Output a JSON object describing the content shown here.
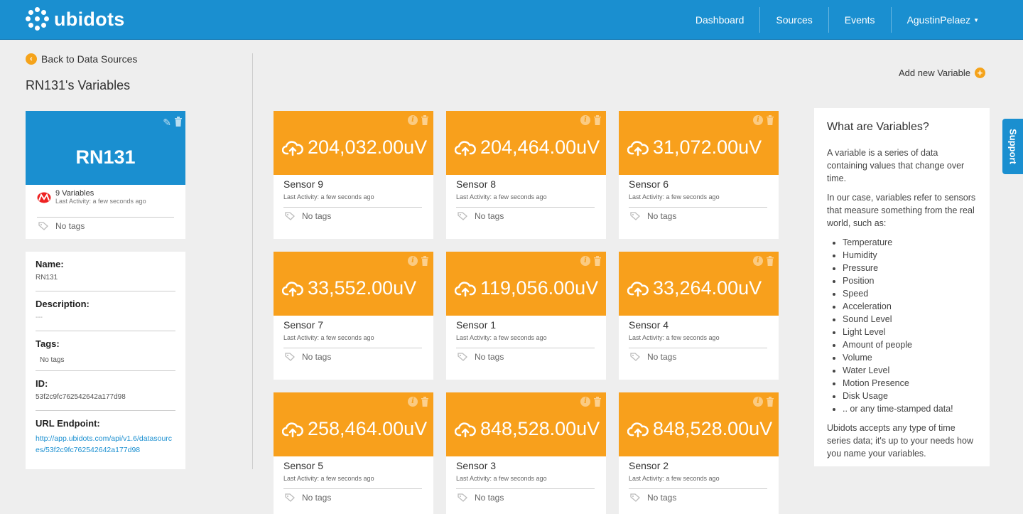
{
  "header": {
    "brand": "ubidots",
    "nav": [
      {
        "label": "Dashboard"
      },
      {
        "label": "Sources"
      },
      {
        "label": "Events"
      },
      {
        "label": "AgustinPelaez"
      }
    ],
    "brand_color": "#1a8fd0"
  },
  "sidebar": {
    "back_label": "Back to Data Sources",
    "page_title": "RN131's Variables",
    "device": {
      "name": "RN131",
      "variables_count": "9 Variables",
      "last_activity": "Last Activity: a few seconds ago",
      "tags": "No tags"
    },
    "details": {
      "name_label": "Name:",
      "name_value": "RN131",
      "description_label": "Description:",
      "description_value": "---",
      "tags_label": "Tags:",
      "tags_value": "No tags",
      "id_label": "ID:",
      "id_value": "53f2c9fc762542642a177d98",
      "url_label": "URL Endpoint:",
      "url_value": "http://app.ubidots.com/api/v1.6/datasources/53f2c9fc762542642a177d98"
    }
  },
  "main": {
    "add_variable_label": "Add new Variable",
    "accent_color": "#f8a01c",
    "variables": [
      {
        "value": "204,032.00uV",
        "name": "Sensor 9",
        "activity": "Last Activity: a few seconds ago",
        "tags": "No tags"
      },
      {
        "value": "204,464.00uV",
        "name": "Sensor 8",
        "activity": "Last Activity: a few seconds ago",
        "tags": "No tags"
      },
      {
        "value": "31,072.00uV",
        "name": "Sensor 6",
        "activity": "Last Activity: a few seconds ago",
        "tags": "No tags"
      },
      {
        "value": "33,552.00uV",
        "name": "Sensor 7",
        "activity": "Last Activity: a few seconds ago",
        "tags": "No tags"
      },
      {
        "value": "119,056.00uV",
        "name": "Sensor 1",
        "activity": "Last Activity: a few seconds ago",
        "tags": "No tags"
      },
      {
        "value": "33,264.00uV",
        "name": "Sensor 4",
        "activity": "Last Activity: a few seconds ago",
        "tags": "No tags"
      },
      {
        "value": "258,464.00uV",
        "name": "Sensor 5",
        "activity": "Last Activity: a few seconds ago",
        "tags": "No tags"
      },
      {
        "value": "848,528.00uV",
        "name": "Sensor 3",
        "activity": "Last Activity: a few seconds ago",
        "tags": "No tags"
      },
      {
        "value": "848,528.00uV",
        "name": "Sensor 2",
        "activity": "Last Activity: a few seconds ago",
        "tags": "No tags"
      }
    ]
  },
  "help": {
    "title": "What are Variables?",
    "p1": "A variable is a series of data containing values that change over time.",
    "p2": "In our case, variables refer to sensors that measure something from the real world, such as:",
    "items": [
      "Temperature",
      "Humidity",
      "Pressure",
      "Position",
      "Speed",
      "Acceleration",
      "Sound Level",
      "Light Level",
      "Amount of people",
      "Volume",
      "Water Level",
      "Motion Presence",
      "Disk Usage",
      ".. or any time-stamped data!"
    ],
    "p3": "Ubidots accepts any type of time series data; it's up to your needs how you name your variables."
  },
  "support_label": "Support"
}
